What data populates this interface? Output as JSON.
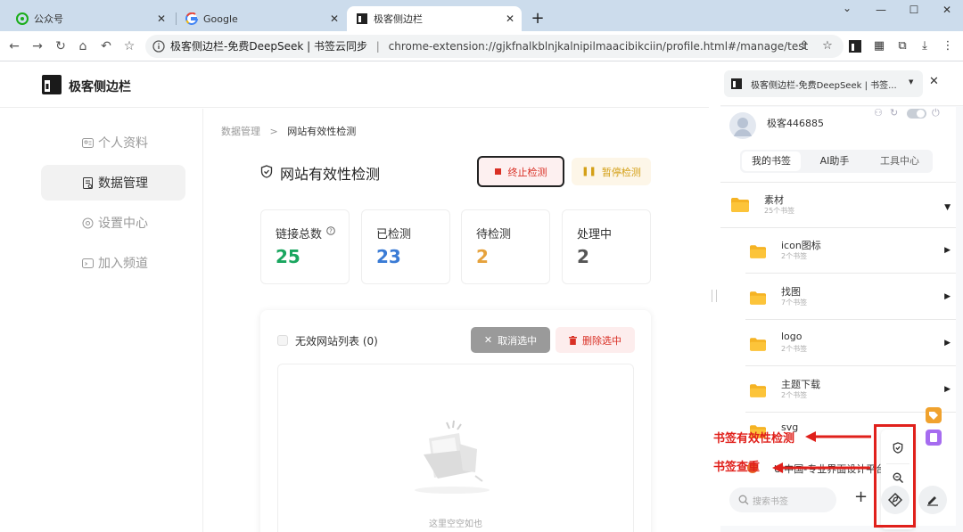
{
  "browser": {
    "tabs": [
      {
        "title": "公众号",
        "icon": "wechat-icon"
      },
      {
        "title": "Google",
        "icon": "google-icon"
      },
      {
        "title": "极客侧边栏",
        "icon": "geek-sidebar-icon"
      }
    ],
    "new_tab": "+",
    "omnibox": {
      "site_title": "极客侧边栏-免费DeepSeek | 书签云同步",
      "separator": "|",
      "url": "chrome-extension://gjkfnalkblnjkalnipilmaacibikciin/profile.html#/manage/test"
    }
  },
  "app": {
    "brand": "极客侧边栏",
    "nav": [
      {
        "label": "个人资料",
        "icon": "user-card-icon",
        "active": false
      },
      {
        "label": "数据管理",
        "icon": "data-icon",
        "active": true
      },
      {
        "label": "设置中心",
        "icon": "settings-icon",
        "active": false
      },
      {
        "label": "加入频道",
        "icon": "channel-icon",
        "active": false
      }
    ],
    "breadcrumb": {
      "parent": "数据管理",
      "separator": ">",
      "current": "网站有效性检测"
    },
    "page_title": "网站有效性检测",
    "stop_button": "终止检测",
    "pause_button": "暂停检测",
    "stats": [
      {
        "label": "链接总数",
        "value": "25",
        "color": "#1aa65f",
        "help": true
      },
      {
        "label": "已检测",
        "value": "23",
        "color": "#3a7bd5",
        "help": false
      },
      {
        "label": "待检测",
        "value": "2",
        "color": "#e6a23c",
        "help": false
      },
      {
        "label": "处理中",
        "value": "2",
        "color": "#555555",
        "help": false
      }
    ],
    "invalid_list": {
      "title": "无效网站列表 (0)",
      "cancel_button": "取消选中",
      "delete_button": "删除选中",
      "empty_text": "这里空空如也"
    }
  },
  "panel": {
    "header_title": "极客侧边栏-免费DeepSeek | 书签...",
    "username": "极客446885",
    "tabs": [
      {
        "label": "我的书签",
        "active": true
      },
      {
        "label": "AI助手",
        "active": false
      },
      {
        "label": "工具中心",
        "active": false
      }
    ],
    "root_folder": {
      "name": "素材",
      "count": "25个书签"
    },
    "folders": [
      {
        "name": "icon图标",
        "count": "2个书签"
      },
      {
        "name": "找图",
        "count": "7个书签"
      },
      {
        "name": "logo",
        "count": "2个书签"
      },
      {
        "name": "主题下载",
        "count": "2个书签"
      },
      {
        "name": "svg",
        "count": ""
      }
    ],
    "bookmark_item": "UI中国-专业界面设计平台",
    "search_placeholder": "搜索书签",
    "add_button": "+"
  },
  "annotations": {
    "validity_check": "书签有效性检测",
    "duplicate_check": "书签查重",
    "color": "#e0201b"
  }
}
